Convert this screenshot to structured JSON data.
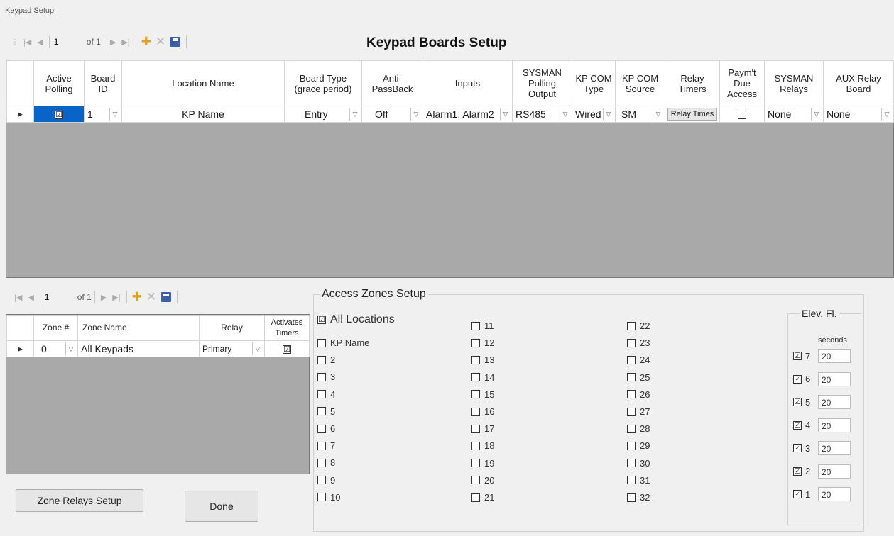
{
  "window_title": "Keypad Setup",
  "boards": {
    "title": "Keypad Boards Setup",
    "nav": {
      "position": "1",
      "of": "of 1"
    },
    "columns": [
      "Active Polling",
      "Board ID",
      "Location Name",
      "Board Type (grace period)",
      "Anti-PassBack",
      "Inputs",
      "SYSMAN Polling Output",
      "KP COM Type",
      "KP COM Source",
      "Relay Timers",
      "Paym't Due Access",
      "SYSMAN Relays",
      "AUX Relay Board"
    ],
    "row": {
      "active_polling": "☑",
      "board_id": "1",
      "location_name": "KP Name",
      "board_type": "Entry",
      "anti_passback": "Off",
      "inputs": "Alarm1, Alarm2",
      "polling_output": "RS485",
      "com_type": "Wired",
      "com_source": "SM",
      "relay_timers_button": "Relay Times",
      "payment_due": "",
      "sysman_relays": "None",
      "aux_relay_board": "None"
    }
  },
  "zones": {
    "nav": {
      "position": "1",
      "of": "of 1"
    },
    "columns": [
      "Zone #",
      "Zone Name",
      "Relay",
      "Activates Timers"
    ],
    "row": {
      "zone_num": "0",
      "zone_name": "All Keypads",
      "relay": "Primary",
      "activates": "☑"
    }
  },
  "buttons": {
    "zone_relays": "Zone Relays Setup",
    "done": "Done"
  },
  "access": {
    "title": "Access Zones Setup",
    "all_locations": "All Locations",
    "col1": [
      "KP Name",
      "2",
      "3",
      "4",
      "5",
      "6",
      "7",
      "8",
      "9",
      "10"
    ],
    "col2": [
      "11",
      "12",
      "13",
      "14",
      "15",
      "16",
      "17",
      "18",
      "19",
      "20",
      "21"
    ],
    "col3": [
      "22",
      "23",
      "24",
      "25",
      "26",
      "27",
      "28",
      "29",
      "30",
      "31",
      "32"
    ]
  },
  "elev": {
    "title": "Elev. Fl.",
    "seconds_label": "seconds",
    "floors": [
      {
        "floor": "7",
        "seconds": "20"
      },
      {
        "floor": "6",
        "seconds": "20"
      },
      {
        "floor": "5",
        "seconds": "20"
      },
      {
        "floor": "4",
        "seconds": "20"
      },
      {
        "floor": "3",
        "seconds": "20"
      },
      {
        "floor": "2",
        "seconds": "20"
      },
      {
        "floor": "1",
        "seconds": "20"
      }
    ]
  },
  "colors": {
    "selection": "#0a64c8",
    "grid_bg": "#a9a9a9",
    "window_bg": "#f0f0f0"
  }
}
